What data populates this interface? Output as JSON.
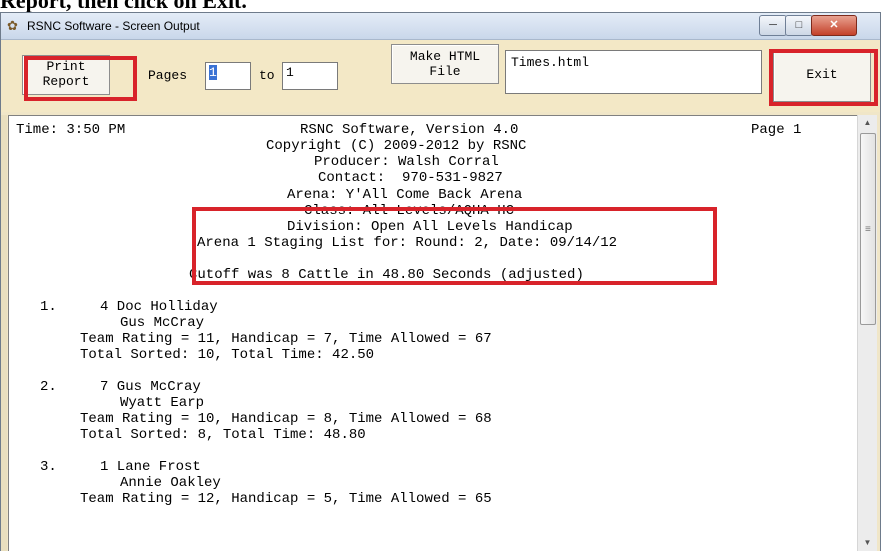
{
  "caption": "Report, then click on Exit.",
  "window": {
    "title": "RSNC Software - Screen Output",
    "icon": "app-icon"
  },
  "toolbar": {
    "print_label_1": "Print",
    "print_label_2": "Report",
    "pages_label": "Pages",
    "pages_from": "1",
    "to_label": "to",
    "pages_to": "1",
    "html_label_1": "Make HTML",
    "html_label_2": "File",
    "filename": "Times.html",
    "exit_label": "Exit"
  },
  "report": {
    "time": "Time: 3:50 PM",
    "version": "RSNC Software, Version 4.0",
    "page": "Page 1",
    "copyright": "Copyright (C) 2009-2012 by RSNC",
    "producer": "Producer: Walsh Corral",
    "contact": "Contact:  970-531-9827",
    "arena": "Arena: Y'All Come Back Arena",
    "class": "Class: All Levels/AQHA HC",
    "division": "Division: Open All Levels Handicap",
    "staging": "Arena 1 Staging List for: Round: 2, Date: 09/14/12",
    "cutoff": "Cutoff was 8 Cattle in 48.80 Seconds (adjusted)",
    "entries": [
      {
        "rank": "1.",
        "team": "4 Doc Holliday",
        "rider2": "Gus McCray",
        "rating": "Team Rating = 11, Handicap = 7, Time Allowed = 67",
        "total": "Total Sorted: 10, Total Time: 42.50"
      },
      {
        "rank": "2.",
        "team": "7 Gus McCray",
        "rider2": "Wyatt Earp",
        "rating": "Team Rating = 10, Handicap = 8, Time Allowed = 68",
        "total": "Total Sorted: 8, Total Time: 48.80"
      },
      {
        "rank": "3.",
        "team": "1 Lane Frost",
        "rider2": "Annie Oakley",
        "rating": "Team Rating = 12, Handicap = 5, Time Allowed = 65",
        "total": ""
      }
    ]
  },
  "colors": {
    "highlight": "#d8232a",
    "toolbar_bg": "#f3e8c6",
    "selection": "#3a72d4"
  }
}
